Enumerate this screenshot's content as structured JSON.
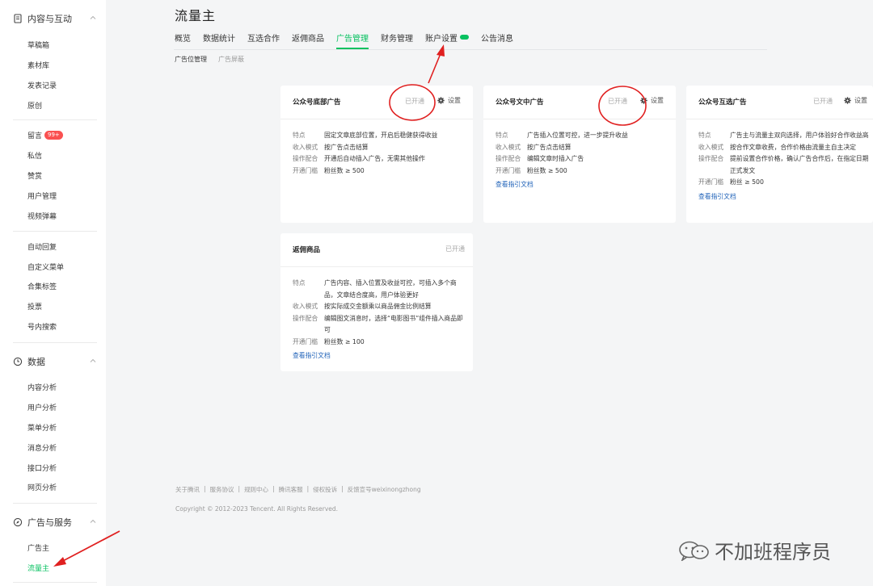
{
  "sidebar": {
    "group_content": "内容与互动",
    "content_items": [
      "草稿箱",
      "素材库",
      "发表记录",
      "原创"
    ],
    "interact_items": [
      {
        "label": "留言",
        "badge": "99+"
      },
      {
        "label": "私信"
      },
      {
        "label": "赞赏"
      },
      {
        "label": "用户管理"
      },
      {
        "label": "视频弹幕"
      }
    ],
    "tool_items": [
      "自动回复",
      "自定义菜单",
      "合集标签",
      "投票",
      "号内搜索"
    ],
    "group_data": "数据",
    "data_items": [
      "内容分析",
      "用户分析",
      "菜单分析",
      "消息分析",
      "接口分析",
      "网页分析"
    ],
    "group_ads": "广告与服务",
    "ads_items": [
      "广告主",
      "流量主"
    ]
  },
  "page": {
    "title": "流量主",
    "tabs": [
      "概览",
      "数据统计",
      "互选合作",
      "返佣商品",
      "广告管理",
      "财务管理",
      "账户设置",
      "公告消息"
    ],
    "active_tab": "广告管理",
    "subtabs": [
      "广告位管理",
      "广告屏蔽"
    ]
  },
  "labels": {
    "feature": "特点",
    "income": "收入模式",
    "operation": "操作配合",
    "threshold": "开通门槛",
    "doc_link": "查看指引文档",
    "settings": "设置"
  },
  "cards": [
    {
      "title": "公众号底部广告",
      "status": "已开通",
      "feature": "固定文章底部位置，开启后稳健获得收益",
      "income": "按广告点击结算",
      "operation": "开通后自动插入广告，无需其他操作",
      "threshold": "粉丝数 ≥ 500"
    },
    {
      "title": "公众号文中广告",
      "status": "已开通",
      "feature": "广告插入位置可控，进一步提升收益",
      "income": "按广告点击结算",
      "operation": "编辑文章时插入广告",
      "threshold": "粉丝数 ≥ 500"
    },
    {
      "title": "公众号互选广告",
      "status": "已开通",
      "feature": "广告主与流量主双向选择，用户体验好合作收益高",
      "income": "按合作文章收费，合作价格由流量主自主决定",
      "operation": "提前设置合作价格，确认广告合作后，在指定日期正式发文",
      "threshold": "粉丝 ≥ 500"
    },
    {
      "title": "返佣商品",
      "status": "已开通",
      "feature": "广告内容、插入位置及收益可控，可插入多个商品，文章结合度高，用户体验更好",
      "income": "按实际成交金额乘以商品佣金比例结算",
      "operation": "编辑图文消息时，选择“电影图书”组件插入商品即可",
      "threshold": "粉丝数 ≥ 100"
    }
  ],
  "footer": {
    "links": [
      "关于腾讯",
      "服务协议",
      "规则中心",
      "腾讯客服",
      "侵权投诉",
      "反馈宣号weixinongzhong"
    ],
    "copyright": "Copyright © 2012-2023 Tencent. All Rights Reserved."
  },
  "watermark": "不加班程序员",
  "colors": {
    "accent": "#07c160",
    "badge": "#fa5151",
    "link": "#1f62b8",
    "annotation": "#e02020"
  }
}
